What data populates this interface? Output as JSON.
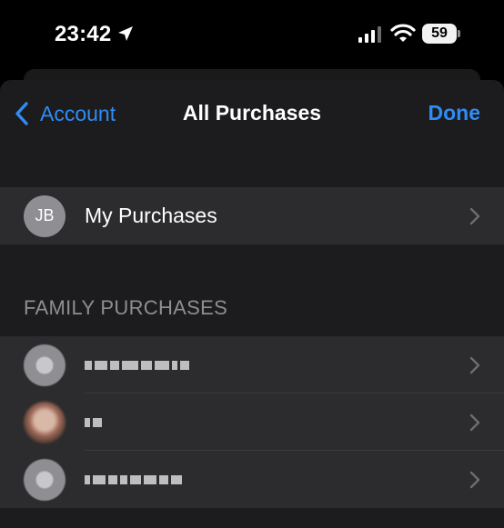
{
  "status_bar": {
    "time": "23:42",
    "battery": "59",
    "icons": [
      "location-arrow-icon",
      "cellular-signal-icon",
      "wifi-icon",
      "battery-icon"
    ]
  },
  "nav": {
    "back_label": "Account",
    "title": "All Purchases",
    "done_label": "Done"
  },
  "my_purchases": {
    "initials": "JB",
    "label": "My Purchases"
  },
  "family_section": {
    "header": "FAMILY PURCHASES"
  },
  "colors": {
    "accent": "#2f8cf5",
    "sheet_bg": "#1c1c1e",
    "row_bg": "#2c2c2e",
    "secondary_text": "#8e8e93"
  }
}
